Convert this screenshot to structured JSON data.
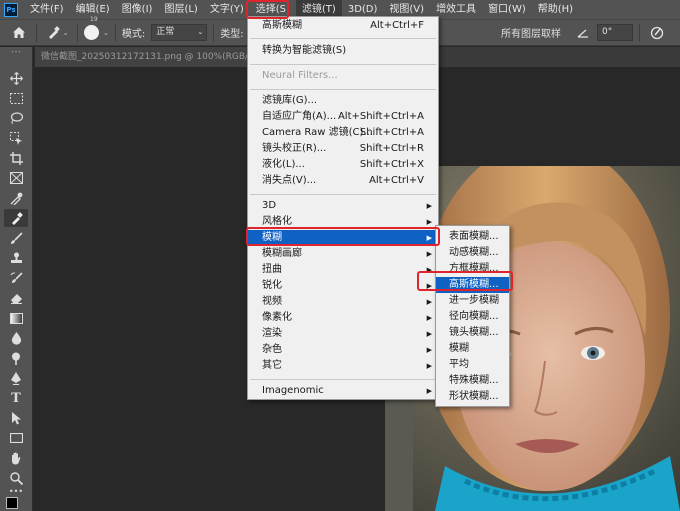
{
  "menubar": {
    "logo": "Ps",
    "items": [
      "文件(F)",
      "编辑(E)",
      "图像(I)",
      "图层(L)",
      "文字(Y)",
      "选择(S)",
      "滤镜(T)",
      "3D(D)",
      "视图(V)",
      "增效工具",
      "窗口(W)",
      "帮助(H)"
    ]
  },
  "options": {
    "brush_size": "19",
    "mode_label": "模式:",
    "mode_value": "正常",
    "type_label": "类型:",
    "sample_all": "所有图层取样",
    "angle_value": "0°"
  },
  "document": {
    "tab_title": "微信截图_20250312172131.png @ 100%(RGB/8#)"
  },
  "filter_menu": {
    "items": [
      {
        "label": "高斯模糊",
        "shortcut": "Alt+Ctrl+F"
      },
      {
        "label": "转换为智能滤镜(S)",
        "shortcut": ""
      },
      {
        "label": "Neural Filters...",
        "shortcut": "",
        "disabled": true
      },
      {
        "label": "滤镜库(G)...",
        "shortcut": ""
      },
      {
        "label": "自适应广角(A)...",
        "shortcut": "Alt+Shift+Ctrl+A"
      },
      {
        "label": "Camera Raw 滤镜(C)...",
        "shortcut": "Shift+Ctrl+A"
      },
      {
        "label": "镜头校正(R)...",
        "shortcut": "Shift+Ctrl+R"
      },
      {
        "label": "液化(L)...",
        "shortcut": "Shift+Ctrl+X"
      },
      {
        "label": "消失点(V)...",
        "shortcut": "Alt+Ctrl+V"
      },
      {
        "label": "3D",
        "shortcut": ""
      },
      {
        "label": "风格化",
        "shortcut": ""
      },
      {
        "label": "模糊",
        "shortcut": ""
      },
      {
        "label": "模糊画廊",
        "shortcut": ""
      },
      {
        "label": "扭曲",
        "shortcut": ""
      },
      {
        "label": "锐化",
        "shortcut": ""
      },
      {
        "label": "视频",
        "shortcut": ""
      },
      {
        "label": "像素化",
        "shortcut": ""
      },
      {
        "label": "渲染",
        "shortcut": ""
      },
      {
        "label": "杂色",
        "shortcut": ""
      },
      {
        "label": "其它",
        "shortcut": ""
      },
      {
        "label": "Imagenomic",
        "shortcut": ""
      }
    ]
  },
  "blur_submenu": {
    "items": [
      "表面模糊...",
      "动感模糊...",
      "方框模糊...",
      "高斯模糊...",
      "进一步模糊",
      "径向模糊...",
      "镜头模糊...",
      "模糊",
      "平均",
      "特殊模糊...",
      "形状模糊..."
    ]
  },
  "colors": {
    "highlight": "#0f62c4",
    "annotation": "#e0242c"
  }
}
